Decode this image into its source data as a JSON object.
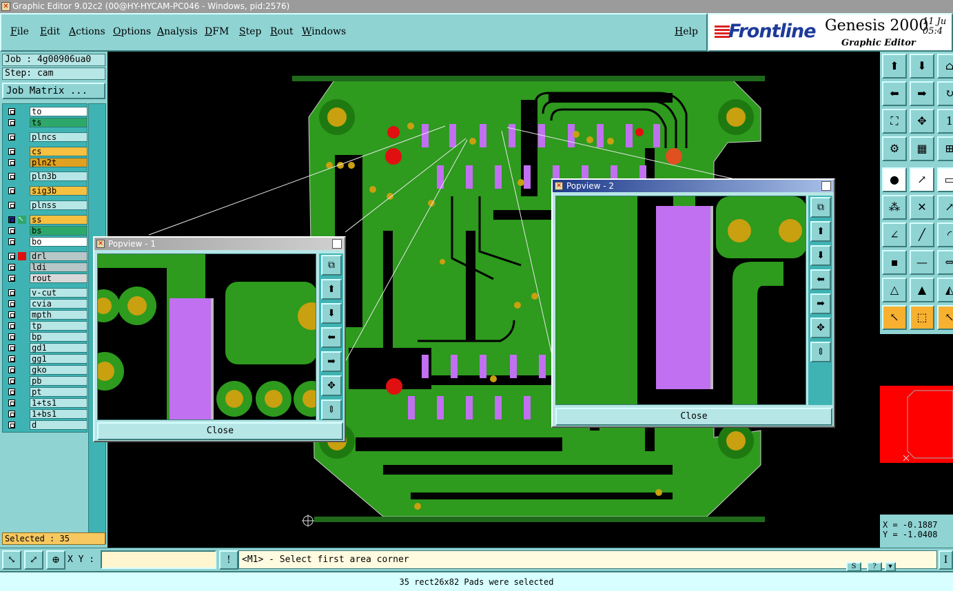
{
  "window": {
    "title": "Graphic Editor 9.02c2 (00@HY-HYCAM-PC046 - Windows, pid:2576)"
  },
  "menu": {
    "items": [
      "File",
      "Edit",
      "Actions",
      "Options",
      "Analysis",
      "DFM",
      "Step",
      "Rout",
      "Windows"
    ],
    "help": "Help"
  },
  "brand": {
    "logo": "Frontline",
    "product": "Genesis 2000",
    "subtitle": "Graphic Editor",
    "date_line1": "11 Ju",
    "date_line2": "05:4"
  },
  "job": {
    "job": "Job : 4g00906ua0",
    "step": "Step: cam",
    "matrix_button": "Job Matrix ..."
  },
  "layers": [
    {
      "name": "to",
      "color": "#ffffff"
    },
    {
      "name": "ts",
      "color": "#2ea86a"
    },
    {
      "name": "plncs",
      "color": "#b7e6e6"
    },
    {
      "name": "cs",
      "color": "#f7c040"
    },
    {
      "name": "pln2t",
      "color": "#e0a020"
    },
    {
      "name": "pln3b",
      "color": "#b7e6e6"
    },
    {
      "name": "sig3b",
      "color": "#f7c040"
    },
    {
      "name": "plnss",
      "color": "#b7e6e6"
    },
    {
      "name": "ss",
      "color": "#f7c040"
    },
    {
      "name": "bs",
      "color": "#2ea86a"
    },
    {
      "name": "bo",
      "color": "#ffffff"
    },
    {
      "name": "drl",
      "color": "#b7c7c7"
    },
    {
      "name": "ldi",
      "color": "#b7c7c7"
    },
    {
      "name": "rout",
      "color": "#d8d8d8"
    },
    {
      "name": "v-cut",
      "color": "#b7e6e6"
    },
    {
      "name": "cvia",
      "color": "#b7e6e6"
    },
    {
      "name": "mpth",
      "color": "#b7e6e6"
    },
    {
      "name": "tp",
      "color": "#b7e6e6"
    },
    {
      "name": "bp",
      "color": "#b7e6e6"
    },
    {
      "name": "gd1",
      "color": "#b7e6e6"
    },
    {
      "name": "gg1",
      "color": "#b7e6e6"
    },
    {
      "name": "gko",
      "color": "#b7e6e6"
    },
    {
      "name": "pb",
      "color": "#b7e6e6"
    },
    {
      "name": "pt",
      "color": "#b7e6e6"
    },
    {
      "name": "1+ts1",
      "color": "#b7e6e6"
    },
    {
      "name": "1+bs1",
      "color": "#b7e6e6"
    },
    {
      "name": "d",
      "color": "#b7e6e6"
    }
  ],
  "selected_count": "Selected : 35",
  "popview1": {
    "title": "Popview - 1",
    "close": "Close"
  },
  "popview2": {
    "title": "Popview - 2",
    "close": "Close"
  },
  "coords": {
    "x": "X = -0.1887",
    "y": "Y = -1.0408"
  },
  "command": {
    "xy_label": "X Y :",
    "xy_value": "",
    "prompt": "<M1> - Select first area corner"
  },
  "status": "35 rect26x82 Pads were selected",
  "colors": {
    "board_green": "#2e9a1e",
    "pad_purple": "#c070f0",
    "pad_gold": "#c8a010",
    "panel": "#8fd3d3"
  }
}
